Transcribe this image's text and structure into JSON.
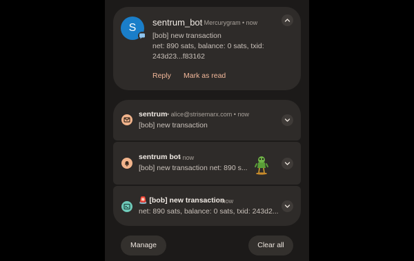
{
  "notifications": {
    "expanded": {
      "avatar_letter": "S",
      "title": "sentrum_bot",
      "app": "• Mercurygram",
      "time": "• now",
      "body_line1": "[bob] new transaction",
      "body_line2": "net: 890 sats, balance: 0 sats, txid:",
      "body_line3": "243d23...f83162",
      "action_reply": "Reply",
      "action_mark_read": "Mark as read"
    },
    "item1": {
      "title": "sentrum",
      "meta": "• alice@strisemarx.com • now",
      "body": "[bob] new transaction"
    },
    "item2": {
      "title": "sentrum bot",
      "meta": "• now",
      "body": "[bob] new transaction net: 890 s..."
    },
    "item3": {
      "emoji": "🚨",
      "title": "[bob] new transaction",
      "meta": "• now",
      "body": "net: 890 sats, balance: 0 sats, txid: 243d2..."
    }
  },
  "footer": {
    "manage_label": "Manage",
    "clear_all_label": "Clear all"
  },
  "icons": {
    "avatar_badge": "chat-bubble-icon",
    "item1_app": "email-icon",
    "item2_app": "bell-icon",
    "item3_app": "terminal-icon",
    "collapse": "chevron-up-icon",
    "expand": "chevron-down-icon"
  },
  "colors": {
    "avatar": "#1a7ec9",
    "action": "#f3b89a",
    "app_icon": "#f2b48c",
    "app_icon_alt": "#6ec9b8"
  }
}
